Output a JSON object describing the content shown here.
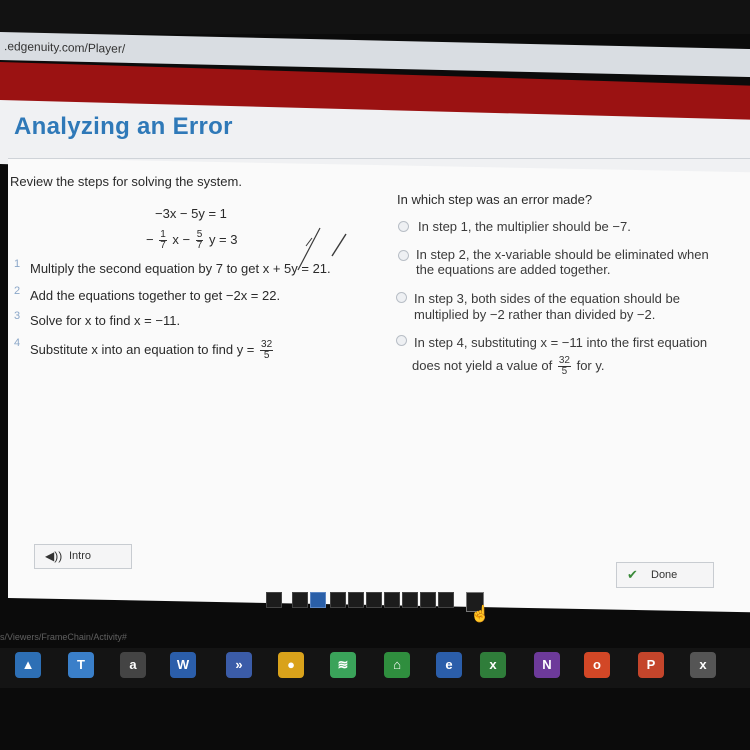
{
  "browser": {
    "url": ".edgenuity.com/Player/"
  },
  "app": {
    "title": "Analyzing an Error"
  },
  "left": {
    "prompt": "Review the steps for solving the system.",
    "system": {
      "eq1": "−3x − 5y = 1",
      "eq2_prefix": "−",
      "eq2_frac1_num": "1",
      "eq2_frac1_den": "7",
      "eq2_mid": "x −",
      "eq2_frac2_num": "5",
      "eq2_frac2_den": "7",
      "eq2_end": "y = 3"
    },
    "steps": [
      {
        "num": "1",
        "text": "Multiply the second equation by 7 to get x + 5y = 21."
      },
      {
        "num": "2",
        "text": "Add the equations together to get −2x = 22."
      },
      {
        "num": "3",
        "text": "Solve for x to find x = −11."
      },
      {
        "num": "4",
        "text": "Substitute x into an equation to find y =",
        "frac_num": "32",
        "frac_den": "5"
      }
    ]
  },
  "right": {
    "question": "In which step was an error made?",
    "options": [
      {
        "line1": "In step 1, the multiplier should be −7."
      },
      {
        "line1": "In step 2, the x-variable should be eliminated when",
        "line2": "the equations are added together."
      },
      {
        "line1": "In step 3, both sides of the equation should be",
        "line2": "multiplied by −2 rather than divided by −2."
      },
      {
        "line1": "In step 4, substituting x = −11 into the first equation",
        "line2_prefix": "does not yield a value of",
        "frac_num": "32",
        "frac_den": "5",
        "line2_suffix": "for y."
      }
    ]
  },
  "footer": {
    "intro_label": "Intro",
    "done_label": "Done",
    "status_url": "s/Viewers/FrameChain/Activity#"
  },
  "taskbar": {
    "icons": [
      {
        "name": "maps-icon",
        "glyph": "▲",
        "color": "#2d6fb5"
      },
      {
        "name": "notepad-icon",
        "glyph": "T",
        "color": "#3a7fc9"
      },
      {
        "name": "amazon-icon",
        "glyph": "a",
        "color": "#444444"
      },
      {
        "name": "word-icon",
        "glyph": "W",
        "color": "#2b5eaa"
      },
      {
        "name": "forward-icon",
        "glyph": "»",
        "color": "#3b5ca8"
      },
      {
        "name": "chrome-icon",
        "glyph": "●",
        "color": "#d9a21b"
      },
      {
        "name": "spotify-icon",
        "glyph": "≋",
        "color": "#3aa35a"
      },
      {
        "name": "green-app-icon",
        "glyph": "⌂",
        "color": "#2f8e3e"
      },
      {
        "name": "edge-icon",
        "glyph": "e",
        "color": "#2b5eaa"
      },
      {
        "name": "excel-icon",
        "glyph": "x",
        "color": "#2f7d3a"
      },
      {
        "name": "onenote-icon",
        "glyph": "N",
        "color": "#6d3a9a"
      },
      {
        "name": "office-icon",
        "glyph": "o",
        "color": "#d24726"
      },
      {
        "name": "powerpoint-icon",
        "glyph": "P",
        "color": "#c4452b"
      },
      {
        "name": "xbox-icon",
        "glyph": "x",
        "color": "#555555"
      }
    ]
  },
  "colors": {
    "accent": "#2f79b8",
    "brand_red": "#9b1212"
  }
}
